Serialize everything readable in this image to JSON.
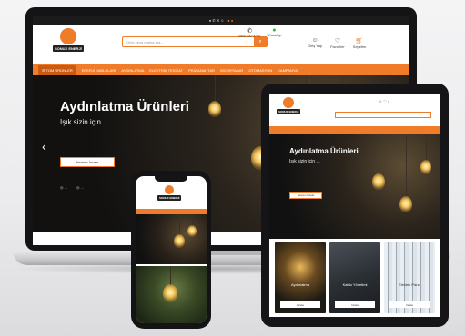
{
  "brand": {
    "name": "SONUX ENERJİ",
    "accent": "#f07c2a",
    "dark": "#1b1b1b"
  },
  "laptop": {
    "topbar": {
      "text": "● ✆ ✉ ☺",
      "highlight": "● ●"
    },
    "search_placeholder": "Ürün veya marka ara...",
    "header_icons": [
      {
        "icon": "phone-icon",
        "label": "0850 000 00 00"
      },
      {
        "icon": "whatsapp-icon",
        "label": "WhatsApp"
      },
      {
        "icon": "user-icon",
        "label": "Giriş Yap"
      },
      {
        "icon": "heart-icon",
        "label": "Favoriler"
      },
      {
        "icon": "cart-icon",
        "label": "Sepetim"
      }
    ],
    "nav_items": [
      "☰ TÜM ÜRÜNLER",
      "ENERJİ KABLOLARI",
      "AYDINLATMA",
      "ELEKTRİK TESİSAT",
      "PRİZ ANAHTAR",
      "SİGORTALAR",
      "OTOMASYON",
      "KAMPANYA"
    ],
    "hero": {
      "title": "Aydınlatma Ürünleri",
      "subtitle": "Işık sizin için ...",
      "button": "Hemen İncele",
      "links": [
        "◎ ...",
        "◎ ..."
      ]
    }
  },
  "tablet": {
    "hero": {
      "title": "Aydınlatma Ürünleri",
      "subtitle": "Işık sizin için ...",
      "button": "Hemen İncele"
    },
    "categories": [
      {
        "caption": "Aydınlatma",
        "button": "İncele"
      },
      {
        "caption": "Kablo Yönetimi",
        "button": "İncele"
      },
      {
        "caption": "Elektrik Pano",
        "button": "İncele"
      }
    ]
  },
  "phone": {
    "brand": "SONUX ENERJİ"
  }
}
